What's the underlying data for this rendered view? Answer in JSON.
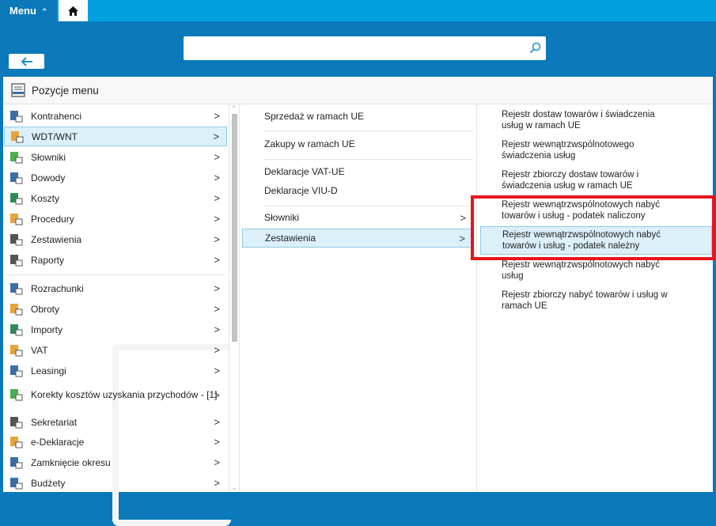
{
  "topbar": {
    "menu_label": "Menu"
  },
  "search": {
    "value": "",
    "placeholder": ""
  },
  "panel": {
    "title": "Pozycje menu"
  },
  "col1": {
    "items": [
      {
        "label": "Kontrahenci",
        "icon": "contractors-icon"
      },
      {
        "label": "WDT/WNT",
        "icon": "wdt-wnt-icon",
        "selected": true
      },
      {
        "label": "Słowniki",
        "icon": "dictionaries-icon"
      },
      {
        "label": "Dowody",
        "icon": "documents-icon"
      },
      {
        "label": "Koszty",
        "icon": "costs-icon"
      },
      {
        "label": "Procedury",
        "icon": "procedures-icon"
      },
      {
        "label": "Zestawienia",
        "icon": "reports-list-icon"
      },
      {
        "label": "Raporty",
        "icon": "reports-icon"
      },
      {
        "label": "Rozrachunki",
        "icon": "settlements-icon"
      },
      {
        "label": "Obroty",
        "icon": "turnover-icon"
      },
      {
        "label": "Importy",
        "icon": "import-icon"
      },
      {
        "label": "VAT",
        "icon": "vat-icon"
      },
      {
        "label": "Leasingi",
        "icon": "leasing-icon"
      },
      {
        "label": "Korekty kosztów uzyskania przychodów - [1]",
        "icon": "corrections-icon"
      },
      {
        "label": "Sekretariat",
        "icon": "secretariat-icon"
      },
      {
        "label": "e-Deklaracje",
        "icon": "e-declarations-icon"
      },
      {
        "label": "Zamknięcie okresu",
        "icon": "period-close-icon"
      },
      {
        "label": "Budżety",
        "icon": "budgets-icon"
      }
    ]
  },
  "col2": {
    "items": [
      {
        "label": "Sprzedaż w ramach UE"
      },
      {
        "label": "Zakupy w ramach UE"
      },
      {
        "label": "Deklaracje VAT-UE"
      },
      {
        "label": "Deklaracje VIU-D"
      },
      {
        "label": "Słowniki",
        "submenu": true
      },
      {
        "label": "Zestawienia",
        "submenu": true,
        "selected": true
      }
    ]
  },
  "col3": {
    "items": [
      {
        "label": "Rejestr dostaw towarów i świadczenia usług w ramach UE"
      },
      {
        "label": "Rejestr wewnątrzwspólnotowego świadczenia usług"
      },
      {
        "label": "Rejestr zbiorczy dostaw towarów i świadczenia usług w ramach UE"
      },
      {
        "label": "Rejestr wewnątrzwspólnotowych nabyć towarów i usług - podatek naliczony",
        "highlighted": true
      },
      {
        "label": "Rejestr wewnątrzwspólnotowych nabyć towarów i usług - podatek należny",
        "selected": true,
        "highlighted": true
      },
      {
        "label": "Rejestr wewnątrzwspólnotowych nabyć usług"
      },
      {
        "label": "Rejestr zbiorczy nabyć towarów i usług w ramach UE"
      }
    ]
  },
  "colors": {
    "header": "#0a78b9",
    "topbar": "#03a0e0",
    "selection": "#dcf0fa",
    "highlight": "#e8141e"
  }
}
